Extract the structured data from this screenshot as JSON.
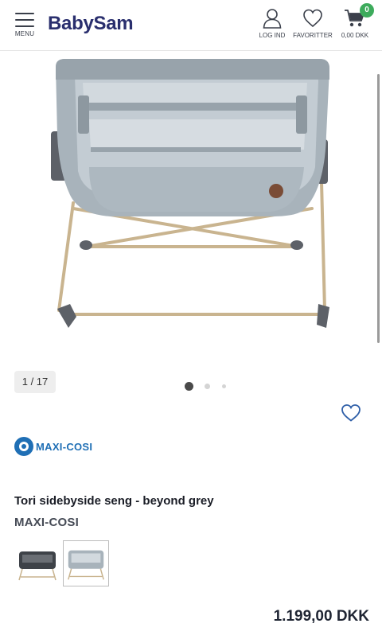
{
  "header": {
    "menu_label": "MENU",
    "logo": "BabySam",
    "login_label": "LOG IND",
    "favorites_label": "FAVORITTER",
    "cart_total": "0,00 DKK",
    "cart_count": "0",
    "accent_color": "#3dab5c"
  },
  "gallery": {
    "counter": "1 / 17",
    "image_alt": "Tori sidebyside seng - beyond grey"
  },
  "product": {
    "brand_logo": "MAXI-COSI",
    "title": "Tori sidebyside seng - beyond grey",
    "brand": "MAXI-COSI",
    "price": "1.199,00 DKK",
    "variants": [
      {
        "name": "dark grey"
      },
      {
        "name": "beyond grey",
        "selected": true
      }
    ]
  }
}
